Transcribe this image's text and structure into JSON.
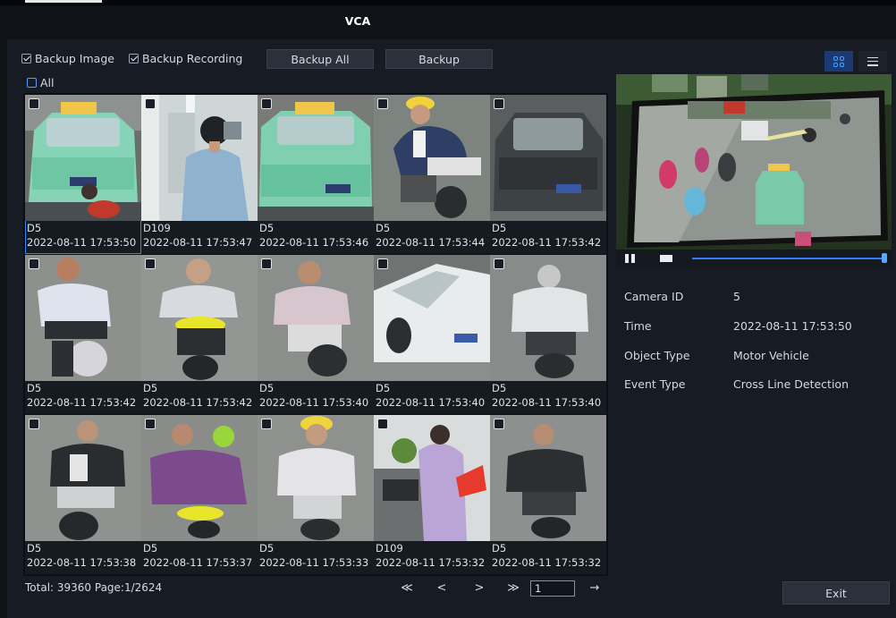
{
  "window": {
    "title": "VCA"
  },
  "toolbar": {
    "backup_image_label": "Backup Image",
    "backup_image_checked": true,
    "backup_recording_label": "Backup Recording",
    "backup_recording_checked": true,
    "backup_all_label": "Backup All",
    "backup_label": "Backup",
    "view_modes": [
      "grid-view-icon",
      "list-view-icon"
    ],
    "active_view": "grid-view-icon"
  },
  "select_all": {
    "label": "All",
    "checked": false
  },
  "results": [
    {
      "camera": "D5",
      "time": "2022-08-11 17:53:50",
      "selected": true
    },
    {
      "camera": "D109",
      "time": "2022-08-11 17:53:47"
    },
    {
      "camera": "D5",
      "time": "2022-08-11 17:53:46"
    },
    {
      "camera": "D5",
      "time": "2022-08-11 17:53:44"
    },
    {
      "camera": "D5",
      "time": "2022-08-11 17:53:42"
    },
    {
      "camera": "D5",
      "time": "2022-08-11 17:53:42"
    },
    {
      "camera": "D5",
      "time": "2022-08-11 17:53:42"
    },
    {
      "camera": "D5",
      "time": "2022-08-11 17:53:40"
    },
    {
      "camera": "D5",
      "time": "2022-08-11 17:53:40"
    },
    {
      "camera": "D5",
      "time": "2022-08-11 17:53:40"
    },
    {
      "camera": "D5",
      "time": "2022-08-11 17:53:38"
    },
    {
      "camera": "D5",
      "time": "2022-08-11 17:53:37"
    },
    {
      "camera": "D5",
      "time": "2022-08-11 17:53:33"
    },
    {
      "camera": "D109",
      "time": "2022-08-11 17:53:32"
    },
    {
      "camera": "D5",
      "time": "2022-08-11 17:53:32"
    }
  ],
  "pagination": {
    "total_text": "Total: 39360  Page:1/2624",
    "first_icon": "≪",
    "prev_icon": "<",
    "next_icon": ">",
    "last_icon": "≫",
    "page_input": "1",
    "go_icon": "→"
  },
  "player": {
    "pause_icon": "pause-icon",
    "stop_icon": "stop-icon",
    "progress": 1.0
  },
  "details": [
    {
      "label": "Camera ID",
      "value": "5"
    },
    {
      "label": "Time",
      "value": "2022-08-11 17:53:50"
    },
    {
      "label": "Object Type",
      "value": "Motor Vehicle"
    },
    {
      "label": "Event Type",
      "value": "Cross Line Detection"
    }
  ],
  "exit_label": "Exit"
}
